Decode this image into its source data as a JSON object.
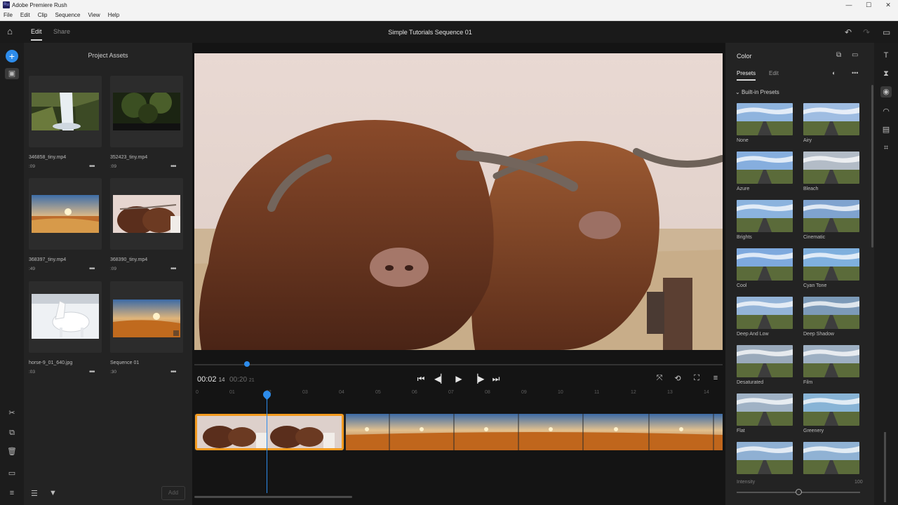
{
  "window": {
    "title": "Adobe Premiere Rush",
    "controls": [
      "—",
      "☐",
      "✕"
    ]
  },
  "menu": [
    "File",
    "Edit",
    "Clip",
    "Sequence",
    "View",
    "Help"
  ],
  "header": {
    "tabs": [
      {
        "label": "Edit"
      },
      {
        "label": "Share"
      }
    ],
    "sequence_title": "Simple Tutorials Sequence 01"
  },
  "assets": {
    "title": "Project Assets",
    "items": [
      {
        "name": "346858_tiny.mp4",
        "duration": ":09"
      },
      {
        "name": "352423_tiny.mp4",
        "duration": ":09"
      },
      {
        "name": "368397_tiny.mp4",
        "duration": ":49"
      },
      {
        "name": "368390_tiny.mp4",
        "duration": ":09"
      },
      {
        "name": "horse-9_01_640.jpg",
        "duration": ":03"
      },
      {
        "name": "Sequence 01",
        "duration": ":30"
      }
    ],
    "add_label": "Add"
  },
  "player": {
    "timecode": "00:02",
    "timecode_suffix": "14",
    "duration": "00:20",
    "duration_suffix": "21",
    "ruler": [
      "0",
      "01",
      "02",
      "03",
      "04",
      "05",
      "06",
      "07",
      "08",
      "09",
      "10",
      "11",
      "12",
      "13",
      "14"
    ]
  },
  "color_panel": {
    "title": "Color",
    "tabs": [
      "Presets",
      "Edit"
    ],
    "section": "Built-in Presets",
    "presets": [
      "None",
      "Airy",
      "Azure",
      "Bleach",
      "Brights",
      "Cinematic",
      "Cool",
      "Cyan Tone",
      "Deep And Low",
      "Deep Shadow",
      "Desaturated",
      "Film",
      "Flat",
      "Greenery",
      "",
      ""
    ],
    "intensity_label": "Intensity",
    "intensity_value": "100",
    "intensity": 0.5
  }
}
